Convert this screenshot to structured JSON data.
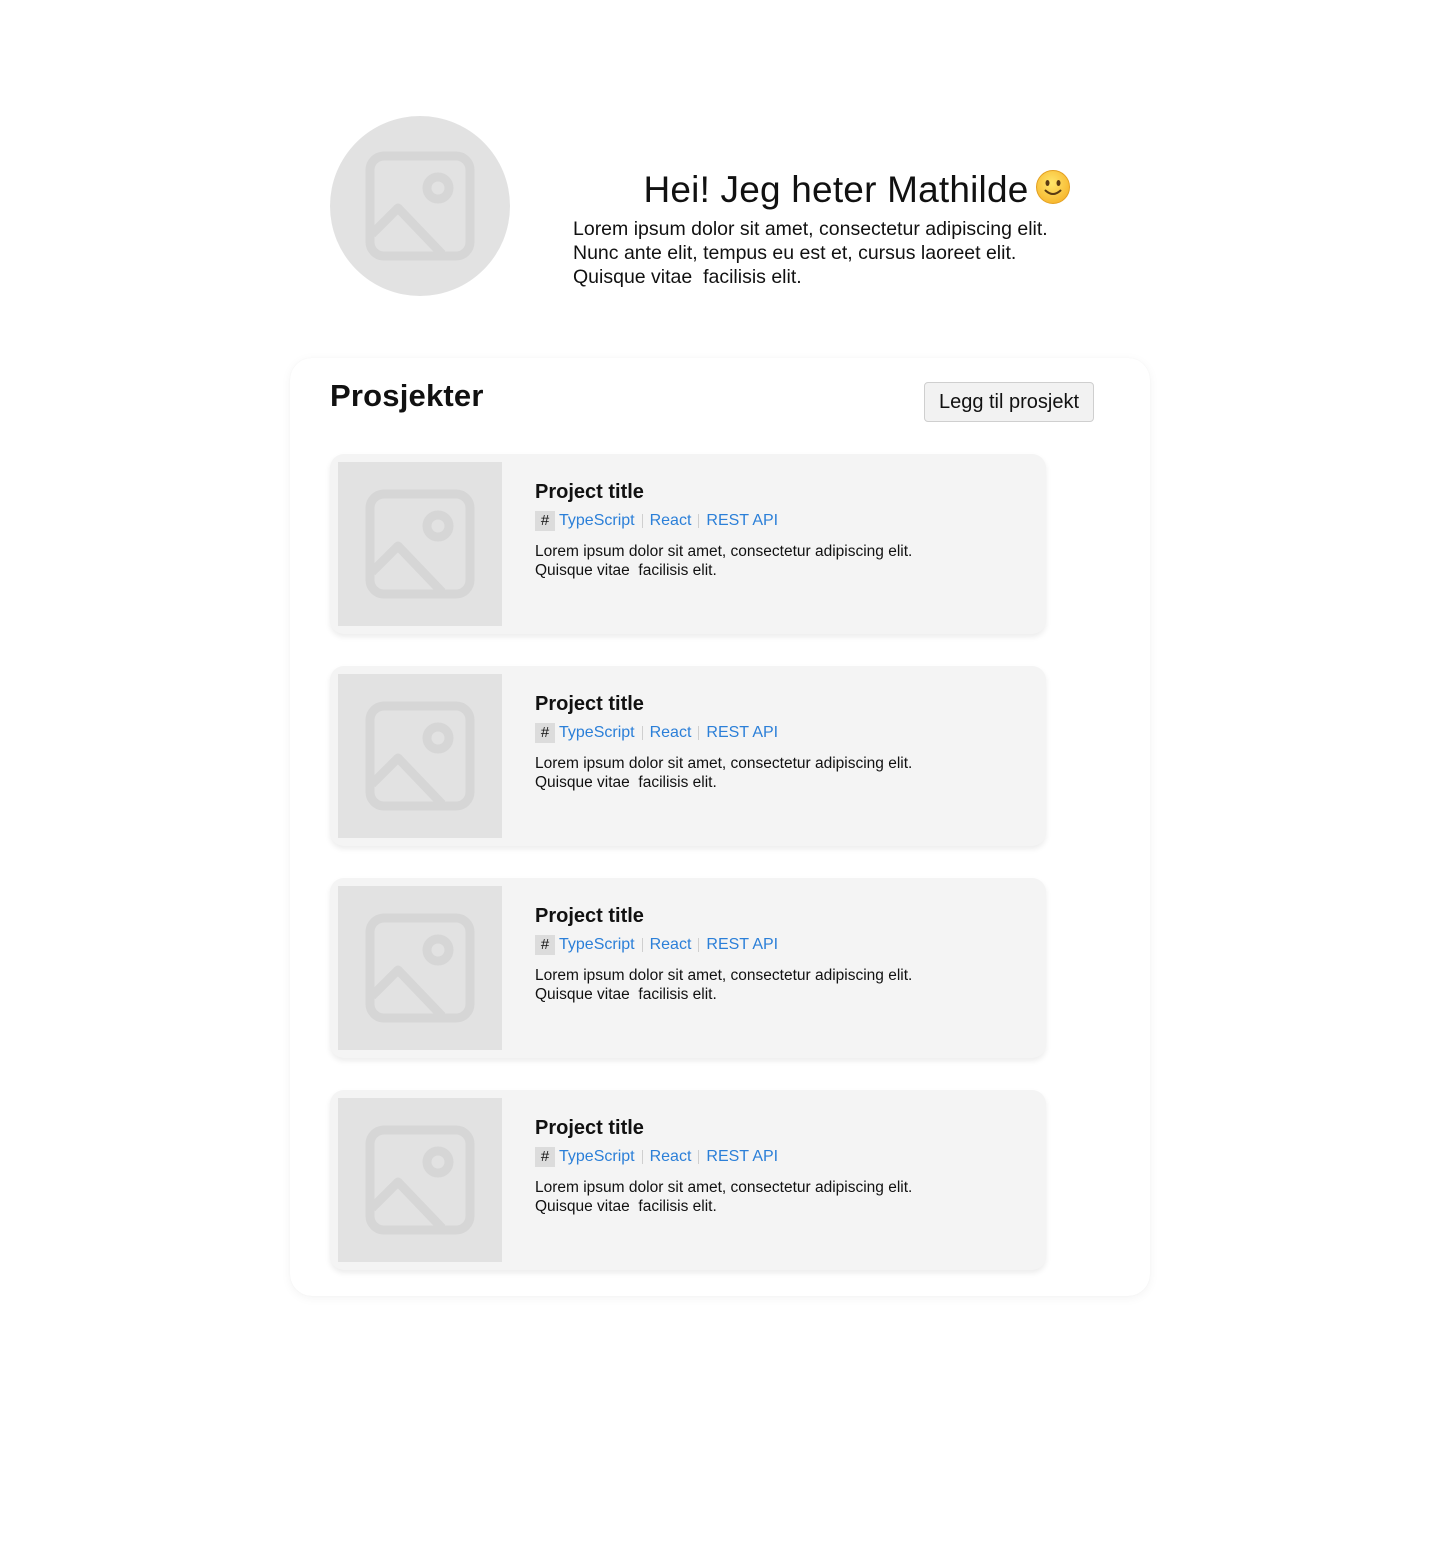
{
  "profile": {
    "avatar_icon": "image-placeholder-icon",
    "title": "Hei! Jeg heter Mathilde",
    "emoji_icon": "slightly-smiling-face-icon",
    "bio_lines": [
      "Lorem ipsum dolor sit amet, consectetur adipiscing elit.",
      "Nunc ante elit, tempus eu est et, cursus laoreet elit.",
      "Quisque vitae  facilisis elit."
    ]
  },
  "projects": {
    "heading": "Prosjekter",
    "add_button_label": "Legg til prosjekt",
    "tag_prefix": "#",
    "link_color": "#2b7fd8",
    "items": [
      {
        "title": "Project title",
        "tags": [
          "TypeScript",
          "React",
          "REST API"
        ],
        "description_lines": [
          "Lorem ipsum dolor sit amet, consectetur adipiscing elit.",
          "Quisque vitae  facilisis elit."
        ]
      },
      {
        "title": "Project title",
        "tags": [
          "TypeScript",
          "React",
          "REST API"
        ],
        "description_lines": [
          "Lorem ipsum dolor sit amet, consectetur adipiscing elit.",
          "Quisque vitae  facilisis elit."
        ]
      },
      {
        "title": "Project title",
        "tags": [
          "TypeScript",
          "React",
          "REST API"
        ],
        "description_lines": [
          "Lorem ipsum dolor sit amet, consectetur adipiscing elit.",
          "Quisque vitae  facilisis elit."
        ]
      },
      {
        "title": "Project title",
        "tags": [
          "TypeScript",
          "React",
          "REST API"
        ],
        "description_lines": [
          "Lorem ipsum dolor sit amet, consectetur adipiscing elit.",
          "Quisque vitae  facilisis elit."
        ]
      }
    ]
  }
}
